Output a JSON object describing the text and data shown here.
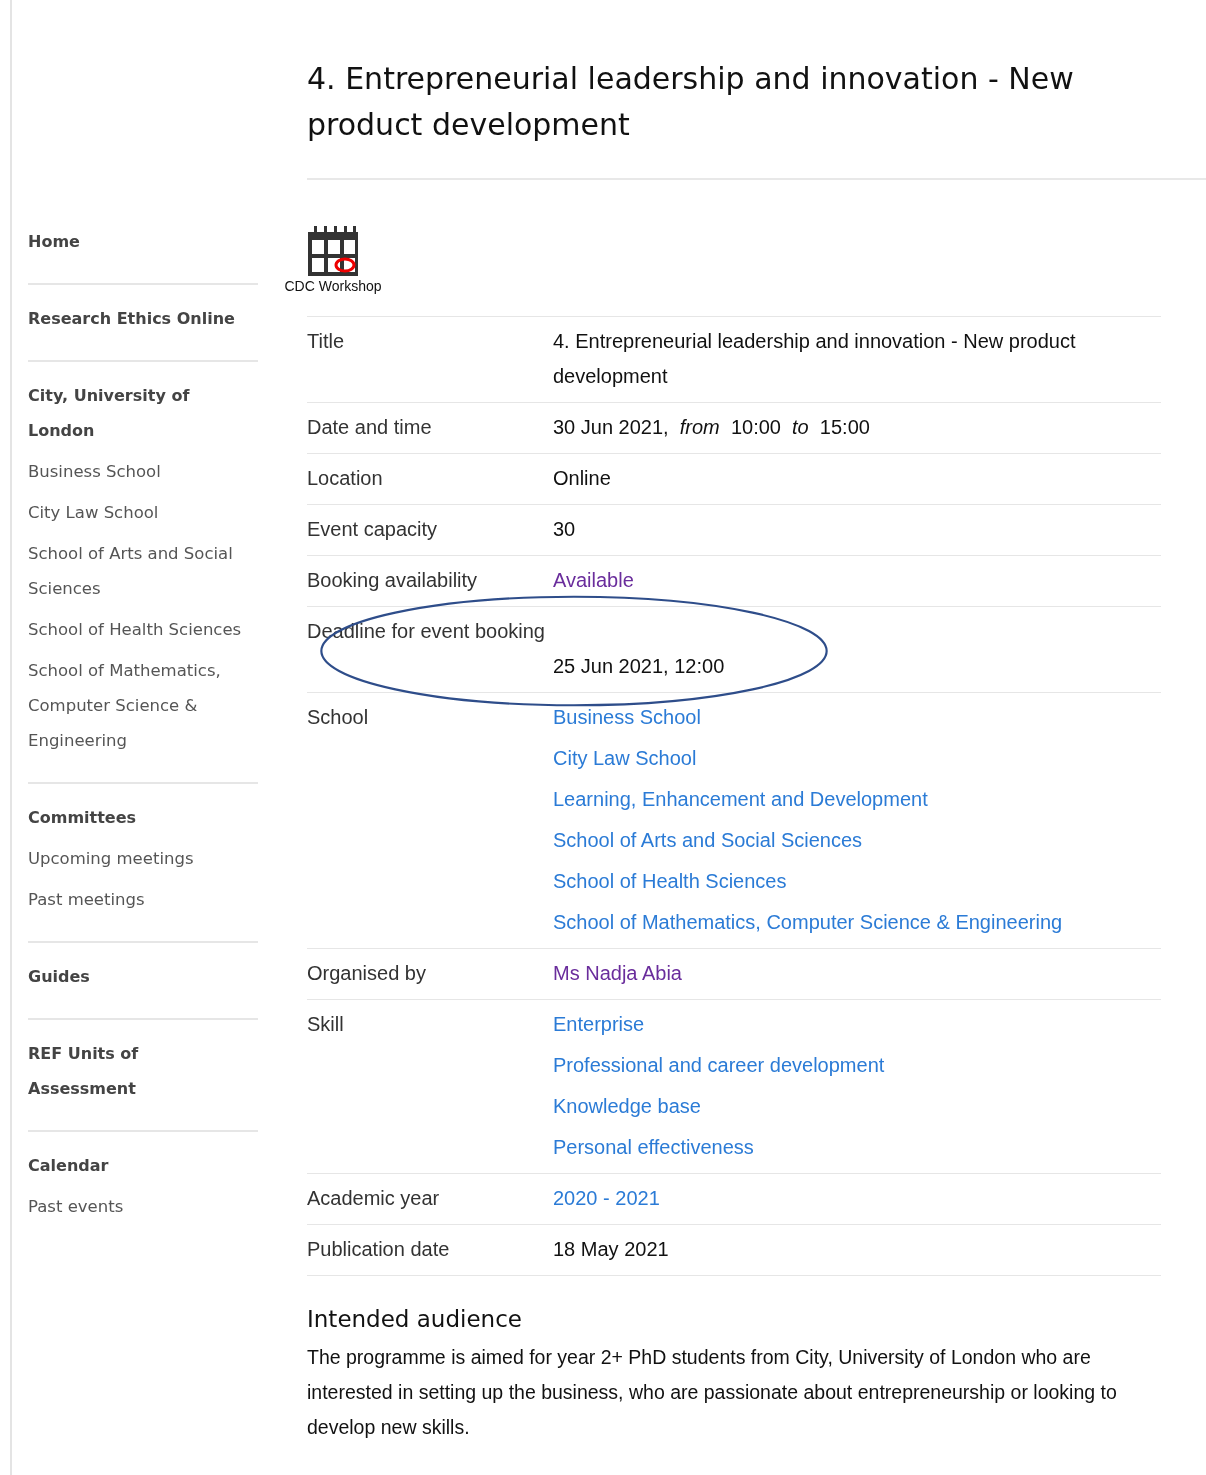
{
  "sidebar": {
    "sections": [
      {
        "heading": "Home"
      },
      {
        "heading": "Research Ethics Online"
      },
      {
        "heading": "City, University of London",
        "items": [
          "Business School",
          "City Law School",
          "School of Arts and Social Sciences",
          "School of Health Sciences",
          "School of Mathematics, Computer Science & Engineering"
        ]
      },
      {
        "heading": "Committees",
        "items": [
          "Upcoming meetings",
          "Past meetings"
        ]
      },
      {
        "heading": "Guides"
      },
      {
        "heading": "REF Units of Assessment"
      },
      {
        "heading": "Calendar",
        "items": [
          "Past events"
        ]
      }
    ]
  },
  "page_title": "4. Entrepreneurial leadership and innovation - New product development",
  "event_type": {
    "label": "CDC Workshop"
  },
  "details": [
    {
      "label": "Title",
      "kind": "text",
      "values": [
        {
          "text": "4. Entrepreneurial leadership and innovation - New product development"
        }
      ]
    },
    {
      "label": "Date and time",
      "kind": "text",
      "values": [
        {
          "text": "30 Jun 2021,  *from*  10:00  *to*  15:00"
        }
      ]
    },
    {
      "label": "Location",
      "kind": "text",
      "values": [
        {
          "text": "Online"
        }
      ]
    },
    {
      "label": "Event capacity",
      "kind": "text",
      "values": [
        {
          "text": "30"
        }
      ]
    },
    {
      "label": "Booking availability",
      "kind": "links",
      "values": [
        {
          "text": "Available",
          "visited": true
        }
      ]
    },
    {
      "label": "Deadline for event booking",
      "kind": "wide",
      "highlighted": true,
      "values": [
        {
          "text": "25 Jun 2021, 12:00"
        }
      ]
    },
    {
      "label": "School",
      "kind": "links",
      "values": [
        {
          "text": "Business School",
          "visited": false
        },
        {
          "text": "City Law School",
          "visited": false
        },
        {
          "text": "Learning, Enhancement and Development",
          "visited": false
        },
        {
          "text": "School of Arts and Social Sciences",
          "visited": false
        },
        {
          "text": "School of Health Sciences",
          "visited": false
        },
        {
          "text": "School of Mathematics, Computer Science & Engineering",
          "visited": false
        }
      ]
    },
    {
      "label": "Organised by",
      "kind": "links",
      "values": [
        {
          "text": "Ms Nadja Abia",
          "visited": true
        }
      ]
    },
    {
      "label": "Skill",
      "kind": "links",
      "values": [
        {
          "text": "Enterprise",
          "visited": false
        },
        {
          "text": "Professional and career development",
          "visited": false
        },
        {
          "text": "Knowledge base",
          "visited": false
        },
        {
          "text": "Personal effectiveness",
          "visited": false
        }
      ]
    },
    {
      "label": "Academic year",
      "kind": "links",
      "values": [
        {
          "text": "2020 - 2021",
          "visited": false
        }
      ]
    },
    {
      "label": "Publication date",
      "kind": "text",
      "values": [
        {
          "text": "18 May 2021"
        }
      ]
    }
  ],
  "audience": {
    "heading": "Intended audience",
    "text": "The programme is aimed for year 2+ PhD students from City, University of London who are interested in setting up the business, who are passionate about entrepreneurship or looking to develop new skills."
  }
}
